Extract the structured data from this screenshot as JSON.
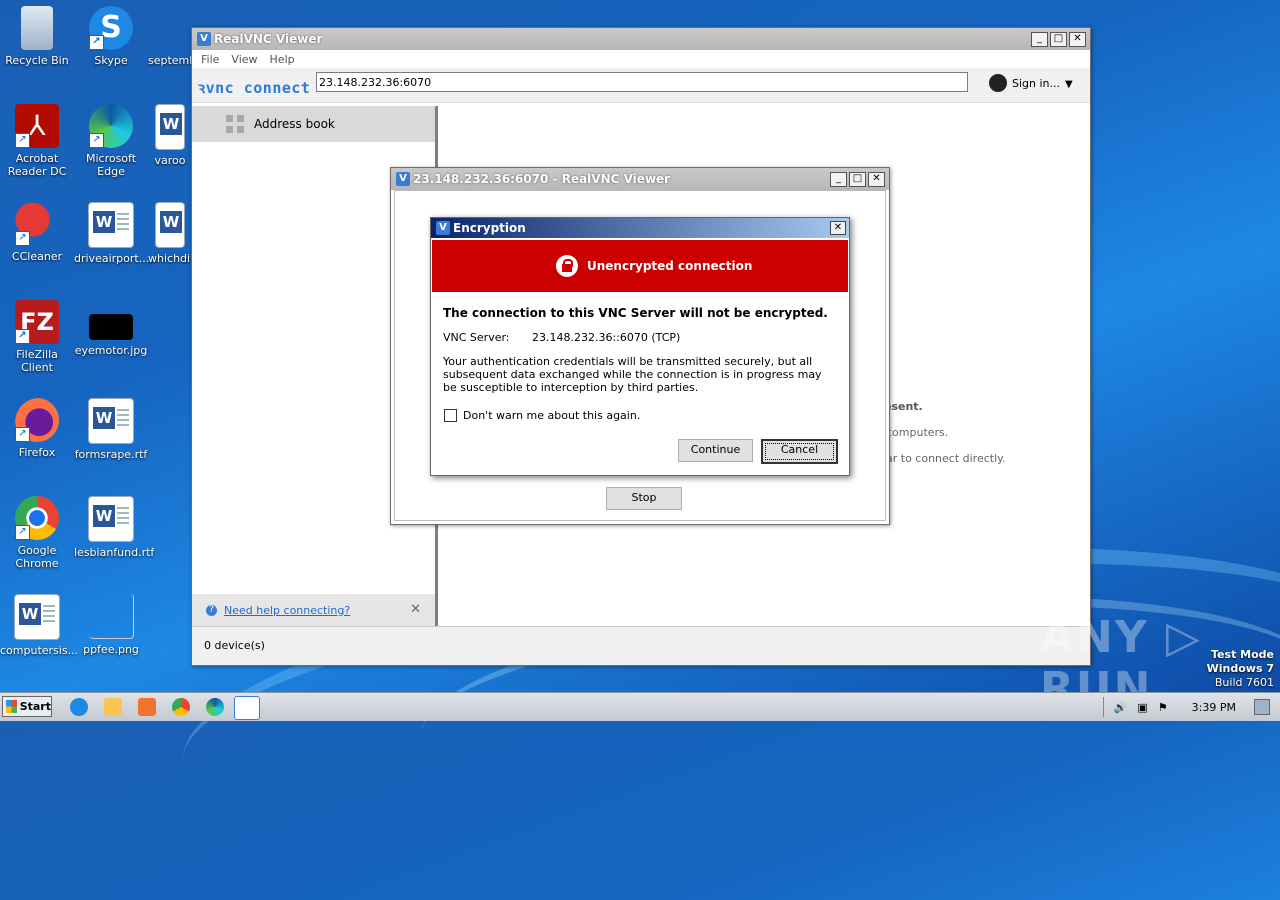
{
  "desktop": {
    "icons": [
      {
        "label": "Recycle Bin"
      },
      {
        "label": "Skype"
      },
      {
        "label": "septemb"
      },
      {
        "label": "Acrobat Reader DC"
      },
      {
        "label": "Microsoft Edge"
      },
      {
        "label": "varoo"
      },
      {
        "label": "CCleaner"
      },
      {
        "label": "driveairport...."
      },
      {
        "label": "whichdis"
      },
      {
        "label": "FileZilla Client"
      },
      {
        "label": "eyemotor.jpg"
      },
      {
        "label": "Firefox"
      },
      {
        "label": "formsrape.rtf"
      },
      {
        "label": "Google Chrome"
      },
      {
        "label": "lesbianfund.rtf"
      },
      {
        "label": "computersis..."
      },
      {
        "label": "ppfee.png"
      }
    ]
  },
  "main_window": {
    "title": "RealVNC Viewer",
    "menu": [
      "File",
      "View",
      "Help"
    ],
    "brand": "ꝛvnc connect",
    "address_value": "23.148.232.36:6070",
    "sign_in": "Sign in...",
    "sidebar": {
      "address_book": "Address book",
      "help_link": "Need help connecting?"
    },
    "background_text": {
      "line1": "esent.",
      "line2": "computers.",
      "line3": "ar to connect directly."
    },
    "status": "0 device(s)"
  },
  "connecting_window": {
    "title": "23.148.232.36:6070 - RealVNC Viewer",
    "stop_label": "Stop"
  },
  "encryption_dialog": {
    "title": "Encryption",
    "banner": "Unencrypted connection",
    "headline": "The connection to this VNC Server will not be encrypted.",
    "server_label": "VNC Server:",
    "server_value": "23.148.232.36::6070 (TCP)",
    "description": "Your authentication credentials will be transmitted securely, but all subsequent data exchanged while the connection is in progress may be susceptible to interception by third parties.",
    "checkbox_label": "Don't warn me about this again.",
    "checkbox_checked": false,
    "continue_label": "Continue",
    "cancel_label": "Cancel",
    "banner_color": "#cc0000"
  },
  "watermark": {
    "brand": "ANY ▷ RUN",
    "mode": "Test Mode",
    "os": "Windows 7",
    "build": "Build 7601"
  },
  "taskbar": {
    "start_label": "Start",
    "clock": "3:39 PM"
  }
}
